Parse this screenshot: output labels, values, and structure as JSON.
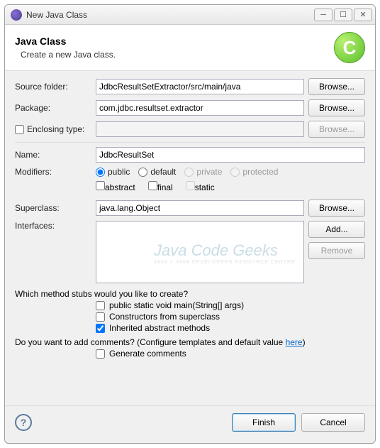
{
  "window": {
    "title": "New Java Class"
  },
  "header": {
    "title": "Java Class",
    "subtitle": "Create a new Java class.",
    "badge_letter": "C"
  },
  "labels": {
    "source_folder": "Source folder:",
    "package": "Package:",
    "enclosing_type": "Enclosing type:",
    "name": "Name:",
    "modifiers": "Modifiers:",
    "superclass": "Superclass:",
    "interfaces": "Interfaces:"
  },
  "fields": {
    "source_folder": "JdbcResultSetExtractor/src/main/java",
    "package": "com.jdbc.resultset.extractor",
    "enclosing_type": "",
    "name": "JdbcResultSet",
    "superclass": "java.lang.Object"
  },
  "modifiers": {
    "public": "public",
    "default": "default",
    "private": "private",
    "protected": "protected",
    "abstract": "abstract",
    "final": "final",
    "static": "static"
  },
  "buttons": {
    "browse": "Browse...",
    "add": "Add...",
    "remove": "Remove",
    "finish": "Finish",
    "cancel": "Cancel"
  },
  "stubs": {
    "question": "Which method stubs would you like to create?",
    "main": "public static void main(String[] args)",
    "constructors": "Constructors from superclass",
    "inherited": "Inherited abstract methods"
  },
  "comments": {
    "question_pre": "Do you want to add comments? (Configure templates and default value ",
    "link": "here",
    "question_post": ")",
    "generate": "Generate comments"
  },
  "watermark": {
    "line1": "Java Code Geeks",
    "line2": "JAVA 2 JAVA DEVELOPERS RESOURCE CENTER"
  }
}
